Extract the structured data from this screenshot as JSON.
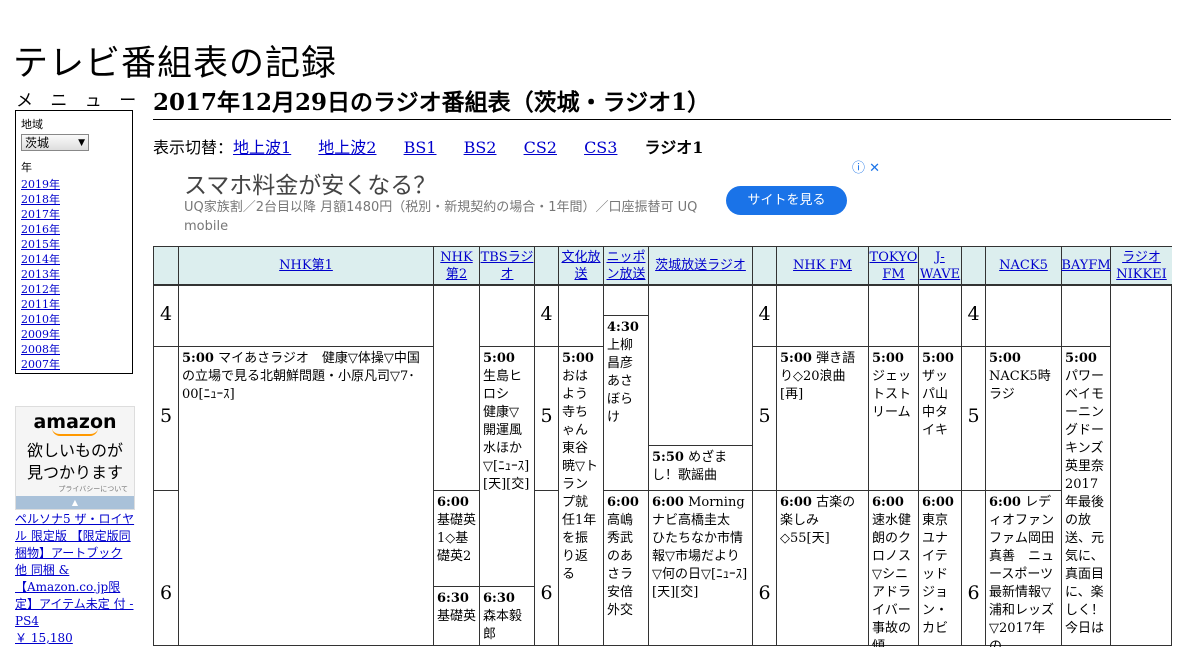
{
  "site": {
    "title": "テレビ番組表の記録"
  },
  "menu": {
    "heading": "メ ニ ュ ー",
    "region_label": "地域",
    "region_value": "茨城",
    "year_label": "年",
    "years": [
      "2019年",
      "2018年",
      "2017年",
      "2016年",
      "2015年",
      "2014年",
      "2013年",
      "2012年",
      "2011年",
      "2010年",
      "2009年",
      "2008年",
      "2007年"
    ]
  },
  "ad_amazon": {
    "logo": "amazon",
    "tagline1": "欲しいものが",
    "tagline2": "見つかります",
    "privacy": "プライバシーについて",
    "product_text": "ペルソナ5 ザ・ロイヤル 限定版 【限定版同梱物】アートブック 他 同梱 & 【Amazon.co.jp限定】アイテム未定 付 - PS4",
    "price": "￥ 15,180"
  },
  "page": {
    "heading": "2017年12月29日のラジオ番組表（茨城・ラジオ1）",
    "switch_label": "表示切替：",
    "switch_links": [
      "地上波1",
      "地上波2",
      "BS1",
      "BS2",
      "CS2",
      "CS3"
    ],
    "switch_current": "ラジオ1"
  },
  "ad_banner": {
    "headline": "スマホ料金が安くなる？",
    "body": "UQ家族割／2台目以降 月額1480円（税別・新規契約の場合・1年間）／口座振替可 UQ mobile",
    "cta": "サイトを見る",
    "ad_marks": "ⓘ ✕"
  },
  "hours": [
    "4",
    "5",
    "6"
  ],
  "channels": {
    "nhk1": "NHK第1",
    "nhk2": "NHK第2",
    "tbs": "TBSラジオ",
    "bunka": "文化放送",
    "nippon": "ニッポン放送",
    "ibaraki": "茨城放送ラジオ",
    "nhkfm": "NHK FM",
    "tokyofm": "TOKYO FM",
    "jwave": "J-WAVE",
    "nack5": "NACK5",
    "bayfm": "BAYFM",
    "nikkei": "ラジオNIKKEI"
  },
  "programs": {
    "nhk1_500": {
      "time": "5:00",
      "title": "マイあさラジオ　健康▽体操▽中国の立場で見る北朝鮮問題・小原凡司▽7･00[ﾆｭｰｽ]"
    },
    "nhk2_600": {
      "time": "6:00",
      "title": "基礎英1◇基礎英2"
    },
    "nhk2_630": {
      "time": "6:30",
      "title": "基礎英"
    },
    "tbs_500": {
      "time": "5:00",
      "title": "生島ヒロシ　健康▽開運風水ほか▽[ﾆｭｰｽ][天][交]"
    },
    "tbs_630": {
      "time": "6:30",
      "title": "森本毅郎"
    },
    "bunka_500": {
      "time": "5:00",
      "title": "おはよう寺ちゃん東谷暁▽トランプ就任1年を振り返る"
    },
    "nippon_430": {
      "time": "4:30",
      "title": "上柳昌彦あさぼらけ"
    },
    "nippon_600": {
      "time": "6:00",
      "title": "高嶋秀武のあさラ安倍外交"
    },
    "ibaraki_550": {
      "time": "5:50",
      "title": "めざまし！歌謡曲"
    },
    "ibaraki_600": {
      "time": "6:00",
      "title": "Morningナビ高橋圭太　ひたちなか市情報▽市場だより▽何の日▽[ﾆｭｰｽ][天][交]"
    },
    "nhkfm_500": {
      "time": "5:00",
      "title": "弾き語り◇20浪曲[再]"
    },
    "nhkfm_600": {
      "time": "6:00",
      "title": "古楽の楽しみ◇55[天]"
    },
    "tokyofm_500": {
      "time": "5:00",
      "title": "ジェットストリーム"
    },
    "tokyofm_600": {
      "time": "6:00",
      "title": "速水健朗のクロノス▽シニアドライバー事故の傾"
    },
    "jwave_500": {
      "time": "5:00",
      "title": "ザッパ山中タイキ"
    },
    "jwave_600": {
      "time": "6:00",
      "title": "東京ユナイテッドジョン・カビ"
    },
    "nack5_500": {
      "time": "5:00",
      "title": "NACK5時ラジ"
    },
    "nack5_600": {
      "time": "6:00",
      "title": "レディオファンファム岡田真善　ニュースポーツ最新情報▽浦和レッズ▽2017年の"
    },
    "bayfm_500": {
      "time": "5:00",
      "title": "パワーベイモーニングドーキンズ英里奈2017年最後の放送、元気に、真面目に、楽しく！今日は"
    }
  }
}
